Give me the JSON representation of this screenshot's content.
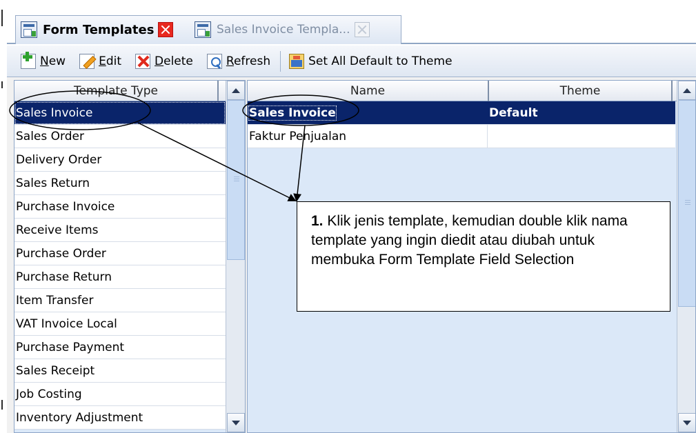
{
  "tabs": [
    {
      "label": "Form Templates",
      "active": true,
      "close_color": "#e8281e"
    },
    {
      "label": "Sales Invoice Templa...",
      "active": false
    }
  ],
  "toolbar": {
    "new_underline": "N",
    "new_rest": "ew",
    "edit_underline": "E",
    "edit_rest": "dit",
    "delete_underline": "D",
    "delete_rest": "elete",
    "refresh_underline": "R",
    "refresh_rest": "efresh",
    "set_theme": "Set All Default to Theme"
  },
  "left_grid": {
    "header": "Template Type",
    "rows": [
      "Sales Invoice",
      "Sales Order",
      "Delivery Order",
      "Sales Return",
      "Purchase Invoice",
      "Receive Items",
      "Purchase Order",
      "Purchase Return",
      "Item Transfer",
      "VAT Invoice Local",
      "Purchase Payment",
      "Sales Receipt",
      "Job Costing",
      "Inventory Adjustment"
    ]
  },
  "right_grid": {
    "headers": {
      "name": "Name",
      "theme": "Theme"
    },
    "rows": [
      {
        "name": "Sales Invoice",
        "theme": "Default"
      },
      {
        "name": "Faktur Penjualan",
        "theme": ""
      }
    ]
  },
  "callout": {
    "number": "1.",
    "text": " Klik jenis template, kemudian double klik nama template yang ingin diedit atau diubah untuk membuka Form Template Field Selection"
  },
  "colors": {
    "selection": "#0a246a",
    "panel_bg": "#dbe8f8",
    "close_red": "#e8281e"
  }
}
